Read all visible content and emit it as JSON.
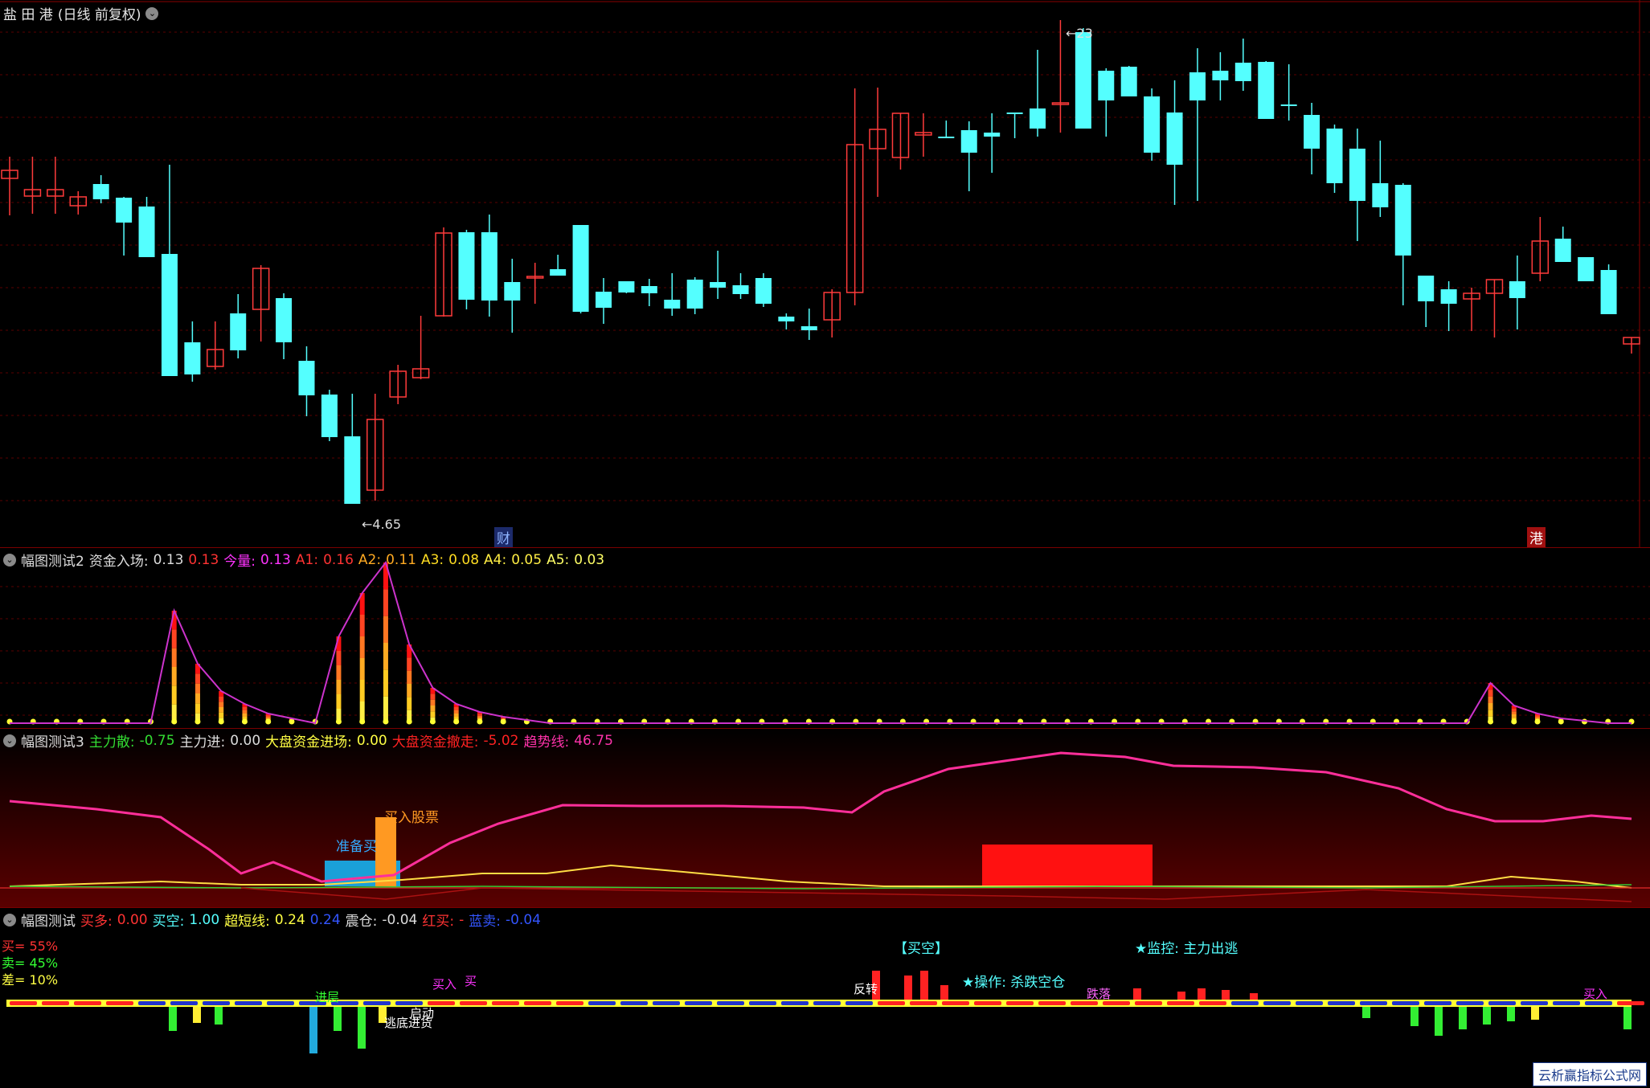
{
  "main": {
    "title": "盐 田 港",
    "period": "(日线 前复权)",
    "menu_icon": "chevron-down-icon",
    "high_label": "23",
    "low_label": "4.65",
    "marker_cai": "财",
    "marker_gang": "港",
    "up_color": "#ff3b3b",
    "down_color": "#54ffff"
  },
  "ind1": {
    "name": "幅图测试2",
    "f1_label": "资金入场:",
    "f1_value": "0.13",
    "f2_value": "0.13",
    "f3_label": "今量:",
    "f3_value": "0.13",
    "f4_label": "A1:",
    "f4_value": "0.16",
    "f5_label": "A2:",
    "f5_value": "0.11",
    "f6_label": "A3:",
    "f6_value": "0.08",
    "f7_label": "A4:",
    "f7_value": "0.05",
    "f8_label": "A5:",
    "f8_value": "0.03"
  },
  "ind2": {
    "name": "幅图测试3",
    "f1_label": "主力散:",
    "f1_value": "-0.75",
    "f2_label": "主力进:",
    "f2_value": "0.00",
    "f3_label": "大盘资金进场:",
    "f3_value": "0.00",
    "f4_label": "大盘资金撤走:",
    "f4_value": "-5.02",
    "f5_label": "趋势线:",
    "f5_value": "46.75",
    "annot_buy": "买入股票",
    "annot_prepare": "准备买"
  },
  "ind3": {
    "name": "幅图测试",
    "f1_label": "买多:",
    "f1_value": "0.00",
    "f2_label": "买空:",
    "f2_value": "1.00",
    "f3_label": "超短线:",
    "f3_value": "0.24",
    "f4_value": "0.24",
    "f5_label": "震仓:",
    "f5_value": "-0.04",
    "f6_label": "红买:",
    "f6_value": "-",
    "f7_label": "蓝卖:",
    "f7_value": "-0.04",
    "buy_pct": "买= 55%",
    "sell_pct": "卖= 45%",
    "diff_pct": "差= 10%",
    "tag_maikong": "【买空】",
    "tag_monitor": "★监控: 主力出逃",
    "tag_operate": "★操作: 杀跌空仓",
    "tag_buy1": "买入",
    "tag_buy2": "买",
    "tag_rebound": "反转",
    "tag_jincang": "进层",
    "tag_qidong": "启动",
    "tag_tiaodi": "逃底进货",
    "tag_dielu": "跌落",
    "tag_buy_right": "买入"
  },
  "watermark": "云析赢指标公式网"
}
